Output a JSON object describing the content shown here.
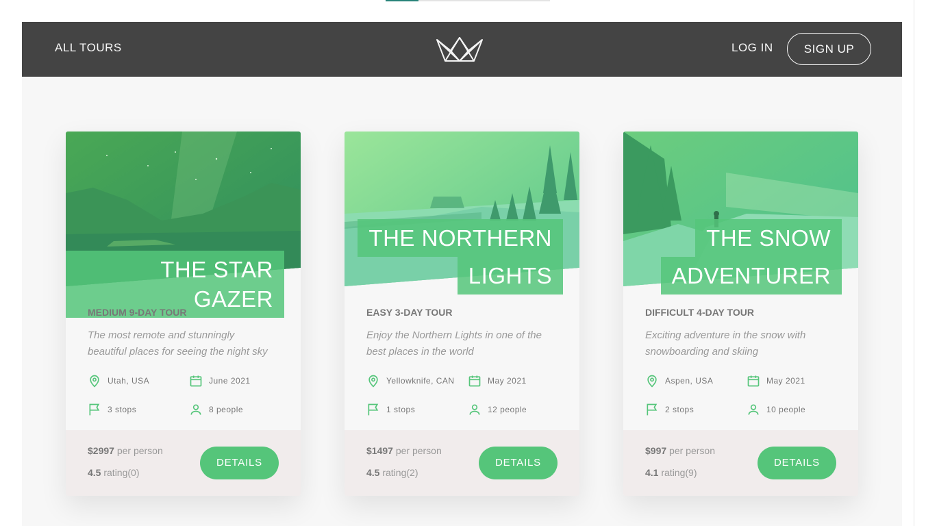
{
  "header": {
    "all_tours": "All tours",
    "login": "Log in",
    "signup": "Sign up"
  },
  "tours": [
    {
      "title_lines": [
        "The Star Gazer"
      ],
      "subheading": "Medium 9-day tour",
      "summary": "The most remote and stunningly beautiful places for seeing the night sky",
      "location": "Utah, USA",
      "date": "June 2021",
      "stops": "3 stops",
      "people": "8 people",
      "price": "$2997",
      "price_suffix": "per person",
      "rating": "4.5",
      "rating_suffix": "rating(0)",
      "details": "Details"
    },
    {
      "title_lines": [
        "The Northern",
        "Lights"
      ],
      "subheading": "Easy 3-day tour",
      "summary": "Enjoy the Northern Lights in one of the best places in the world",
      "location": "Yellowknife, CAN",
      "date": "May 2021",
      "stops": "1 stops",
      "people": "12 people",
      "price": "$1497",
      "price_suffix": "per person",
      "rating": "4.5",
      "rating_suffix": "rating(2)",
      "details": "Details"
    },
    {
      "title_lines": [
        "The Snow",
        "Adventurer"
      ],
      "subheading": "Difficult 4-day tour",
      "summary": "Exciting adventure in the snow with snowboarding and skiing",
      "location": "Aspen, USA",
      "date": "May 2021",
      "stops": "2 stops",
      "people": "10 people",
      "price": "$997",
      "price_suffix": "per person",
      "rating": "4.1",
      "rating_suffix": "rating(9)",
      "details": "Details"
    }
  ],
  "colors": {
    "accent": "#55c57a",
    "header": "#444444",
    "background": "#f7f7f7",
    "footer": "#f1ecec"
  },
  "icons": [
    "crown-logo",
    "map-pin-icon",
    "calendar-icon",
    "flag-icon",
    "user-icon"
  ]
}
